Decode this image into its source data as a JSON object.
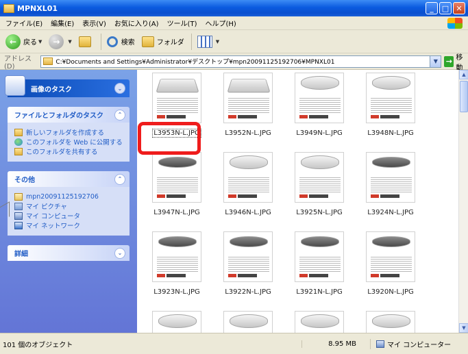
{
  "window": {
    "title": "MPNXL01"
  },
  "menubar": {
    "items": [
      "ファイル(E)",
      "編集(E)",
      "表示(V)",
      "お気に入り(A)",
      "ツール(T)",
      "ヘルプ(H)"
    ]
  },
  "toolbar": {
    "back_label": "戻る",
    "search_label": "検索",
    "folders_label": "フォルダ"
  },
  "address": {
    "label": "アドレス(D)",
    "path": "C:¥Documents and Settings¥Administrator¥デスクトップ¥mpn20091125192706¥MPNXL01",
    "go_label": "移動"
  },
  "leftpane": {
    "special_panel": {
      "title": "画像のタスク"
    },
    "tasks_panel": {
      "title": "ファイルとフォルダのタスク",
      "items": [
        "新しいフォルダを作成する",
        "このフォルダを Web に公開する",
        "このフォルダを共有する"
      ]
    },
    "other_panel": {
      "title": "その他",
      "items": [
        "mpn20091125192706",
        "マイ ピクチャ",
        "マイ コンピュータ",
        "マイ ネットワーク"
      ]
    },
    "details_panel": {
      "title": "詳細"
    }
  },
  "files": {
    "items": [
      {
        "name": "L3953N-L.JPG",
        "selected": true
      },
      {
        "name": "L3952N-L.JPG"
      },
      {
        "name": "L3949N-L.JPG"
      },
      {
        "name": "L3948N-L.JPG"
      },
      {
        "name": "L3947N-L.JPG"
      },
      {
        "name": "L3946N-L.JPG"
      },
      {
        "name": "L3925N-L.JPG"
      },
      {
        "name": "L3924N-L.JPG"
      },
      {
        "name": "L3923N-L.JPG"
      },
      {
        "name": "L3922N-L.JPG"
      },
      {
        "name": "L3921N-L.JPG"
      },
      {
        "name": "L3920N-L.JPG"
      }
    ]
  },
  "statusbar": {
    "count": "101 個のオブジェクト",
    "size": "8.95 MB",
    "zone": "マイ コンピューター"
  },
  "colors": {
    "titlebar": "#0b5be0",
    "highlight": "#ef1c1c",
    "taskpane": "#7ba2e7"
  }
}
